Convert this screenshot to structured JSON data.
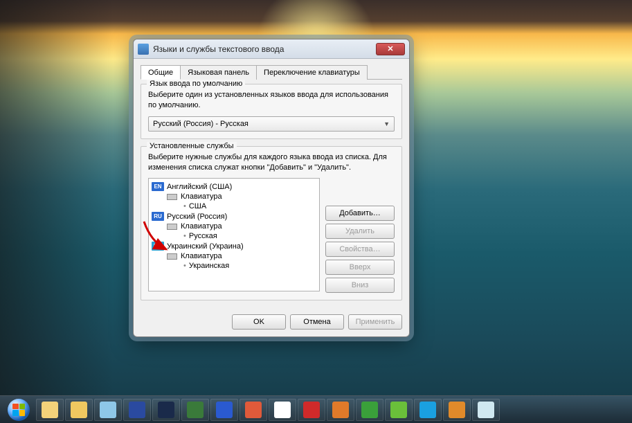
{
  "dialog": {
    "title": "Языки и службы текстового ввода",
    "tabs": [
      "Общие",
      "Языковая панель",
      "Переключение клавиатуры"
    ],
    "active_tab": 0,
    "group_default": {
      "legend": "Язык ввода по умолчанию",
      "desc": "Выберите один из установленных языков ввода для использования по умолчанию.",
      "combo_value": "Русский (Россия) - Русская"
    },
    "group_services": {
      "legend": "Установленные службы",
      "desc": "Выберите нужные службы для каждого языка ввода из списка. Для изменения списка служат кнопки \"Добавить\" и \"Удалить\".",
      "tree": [
        {
          "code": "EN",
          "badge": "badge-en",
          "name": "Английский (США)",
          "keyboard_label": "Клавиатура",
          "layout": "США"
        },
        {
          "code": "RU",
          "badge": "badge-ru",
          "name": "Русский (Россия)",
          "keyboard_label": "Клавиатура",
          "layout": "Русская"
        },
        {
          "code": "UK",
          "badge": "badge-uk",
          "name": "Украинский (Украина)",
          "keyboard_label": "Клавиатура",
          "layout": "Украинская"
        }
      ],
      "buttons": {
        "add": "Добавить…",
        "remove": "Удалить",
        "properties": "Свойства…",
        "up": "Вверх",
        "down": "Вниз"
      }
    },
    "bottom": {
      "ok": "OK",
      "cancel": "Отмена",
      "apply": "Применить"
    }
  },
  "taskbar": {
    "items": [
      {
        "name": "explorer-icon",
        "color": "#f3d27a"
      },
      {
        "name": "folder-icon",
        "color": "#f0c860"
      },
      {
        "name": "notepad-icon",
        "color": "#8ec7e8"
      },
      {
        "name": "save-disk-icon",
        "color": "#2a4aa0"
      },
      {
        "name": "photoshop-icon",
        "color": "#1a2a4a"
      },
      {
        "name": "dreamweaver-icon",
        "color": "#3a7a3a"
      },
      {
        "name": "word-icon",
        "color": "#2a5ad0"
      },
      {
        "name": "chrome-icon",
        "color": "#e05a3a"
      },
      {
        "name": "yandex-icon",
        "color": "#ffffff"
      },
      {
        "name": "opera-icon",
        "color": "#d02a2a"
      },
      {
        "name": "firefox-icon",
        "color": "#e07a2a"
      },
      {
        "name": "torrent-icon",
        "color": "#3aa03a"
      },
      {
        "name": "icq-icon",
        "color": "#6ac03a"
      },
      {
        "name": "skype-icon",
        "color": "#1aa0e0"
      },
      {
        "name": "media-icon",
        "color": "#e08a2a"
      },
      {
        "name": "weather-icon",
        "color": "#d0e8f0"
      }
    ]
  }
}
